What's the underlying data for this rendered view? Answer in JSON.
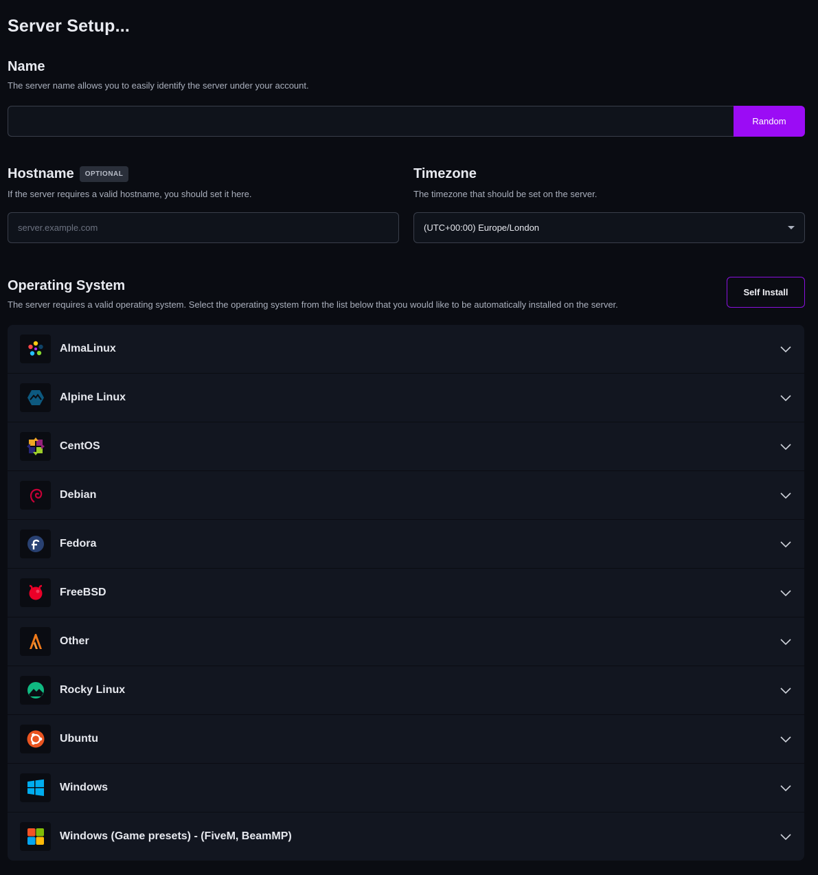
{
  "page": {
    "title": "Server Setup..."
  },
  "name": {
    "title": "Name",
    "description": "The server name allows you to easily identify the server under your account.",
    "value": "",
    "random_label": "Random"
  },
  "hostname": {
    "title": "Hostname",
    "badge": "OPTIONAL",
    "description": "If the server requires a valid hostname, you should set it here.",
    "placeholder": "server.example.com"
  },
  "timezone": {
    "title": "Timezone",
    "description": "The timezone that should be set on the server.",
    "selected": "(UTC+00:00) Europe/London"
  },
  "os": {
    "title": "Operating System",
    "description": "The server requires a valid operating system. Select the operating system from the list below that you would like to be automatically installed on the server.",
    "self_install_label": "Self Install",
    "items": [
      {
        "label": "AlmaLinux",
        "icon": "almalinux-icon"
      },
      {
        "label": "Alpine Linux",
        "icon": "alpine-linux-icon"
      },
      {
        "label": "CentOS",
        "icon": "centos-icon"
      },
      {
        "label": "Debian",
        "icon": "debian-icon"
      },
      {
        "label": "Fedora",
        "icon": "fedora-icon"
      },
      {
        "label": "FreeBSD",
        "icon": "freebsd-icon"
      },
      {
        "label": "Other",
        "icon": "other-os-icon"
      },
      {
        "label": "Rocky Linux",
        "icon": "rocky-linux-icon"
      },
      {
        "label": "Ubuntu",
        "icon": "ubuntu-icon"
      },
      {
        "label": "Windows",
        "icon": "windows-icon"
      },
      {
        "label": "Windows (Game presets) - (FiveM, BeamMP)",
        "icon": "windows-game-presets-icon"
      }
    ]
  },
  "colors": {
    "background": "#0a0c12",
    "accent": "#9b0cf5",
    "panel": "#121620"
  }
}
